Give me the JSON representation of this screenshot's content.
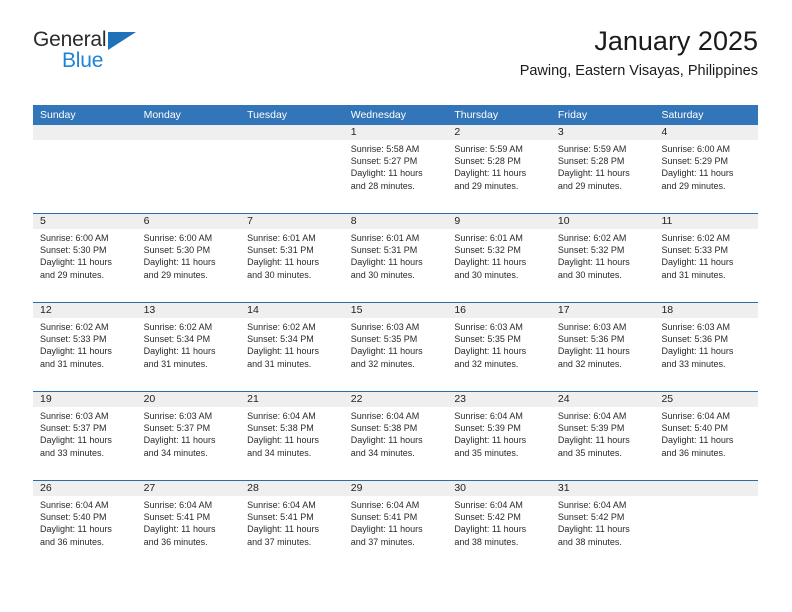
{
  "brand": {
    "name_part1": "General",
    "name_part2": "Blue",
    "triangle_color": "#1e72b8",
    "blue_color": "#1f84d6"
  },
  "header": {
    "title": "January 2025",
    "subtitle": "Pawing, Eastern Visayas, Philippines"
  },
  "theme": {
    "header_blue": "#3275b8",
    "separator_blue": "#2c6ca8",
    "day_band_gray": "#efefef"
  },
  "weekdays": [
    "Sunday",
    "Monday",
    "Tuesday",
    "Wednesday",
    "Thursday",
    "Friday",
    "Saturday"
  ],
  "weeks": [
    [
      {
        "day": "",
        "sunrise": "",
        "sunset": "",
        "daylight1": "",
        "daylight2": ""
      },
      {
        "day": "",
        "sunrise": "",
        "sunset": "",
        "daylight1": "",
        "daylight2": ""
      },
      {
        "day": "",
        "sunrise": "",
        "sunset": "",
        "daylight1": "",
        "daylight2": ""
      },
      {
        "day": "1",
        "sunrise": "Sunrise: 5:58 AM",
        "sunset": "Sunset: 5:27 PM",
        "daylight1": "Daylight: 11 hours",
        "daylight2": "and 28 minutes."
      },
      {
        "day": "2",
        "sunrise": "Sunrise: 5:59 AM",
        "sunset": "Sunset: 5:28 PM",
        "daylight1": "Daylight: 11 hours",
        "daylight2": "and 29 minutes."
      },
      {
        "day": "3",
        "sunrise": "Sunrise: 5:59 AM",
        "sunset": "Sunset: 5:28 PM",
        "daylight1": "Daylight: 11 hours",
        "daylight2": "and 29 minutes."
      },
      {
        "day": "4",
        "sunrise": "Sunrise: 6:00 AM",
        "sunset": "Sunset: 5:29 PM",
        "daylight1": "Daylight: 11 hours",
        "daylight2": "and 29 minutes."
      }
    ],
    [
      {
        "day": "5",
        "sunrise": "Sunrise: 6:00 AM",
        "sunset": "Sunset: 5:30 PM",
        "daylight1": "Daylight: 11 hours",
        "daylight2": "and 29 minutes."
      },
      {
        "day": "6",
        "sunrise": "Sunrise: 6:00 AM",
        "sunset": "Sunset: 5:30 PM",
        "daylight1": "Daylight: 11 hours",
        "daylight2": "and 29 minutes."
      },
      {
        "day": "7",
        "sunrise": "Sunrise: 6:01 AM",
        "sunset": "Sunset: 5:31 PM",
        "daylight1": "Daylight: 11 hours",
        "daylight2": "and 30 minutes."
      },
      {
        "day": "8",
        "sunrise": "Sunrise: 6:01 AM",
        "sunset": "Sunset: 5:31 PM",
        "daylight1": "Daylight: 11 hours",
        "daylight2": "and 30 minutes."
      },
      {
        "day": "9",
        "sunrise": "Sunrise: 6:01 AM",
        "sunset": "Sunset: 5:32 PM",
        "daylight1": "Daylight: 11 hours",
        "daylight2": "and 30 minutes."
      },
      {
        "day": "10",
        "sunrise": "Sunrise: 6:02 AM",
        "sunset": "Sunset: 5:32 PM",
        "daylight1": "Daylight: 11 hours",
        "daylight2": "and 30 minutes."
      },
      {
        "day": "11",
        "sunrise": "Sunrise: 6:02 AM",
        "sunset": "Sunset: 5:33 PM",
        "daylight1": "Daylight: 11 hours",
        "daylight2": "and 31 minutes."
      }
    ],
    [
      {
        "day": "12",
        "sunrise": "Sunrise: 6:02 AM",
        "sunset": "Sunset: 5:33 PM",
        "daylight1": "Daylight: 11 hours",
        "daylight2": "and 31 minutes."
      },
      {
        "day": "13",
        "sunrise": "Sunrise: 6:02 AM",
        "sunset": "Sunset: 5:34 PM",
        "daylight1": "Daylight: 11 hours",
        "daylight2": "and 31 minutes."
      },
      {
        "day": "14",
        "sunrise": "Sunrise: 6:02 AM",
        "sunset": "Sunset: 5:34 PM",
        "daylight1": "Daylight: 11 hours",
        "daylight2": "and 31 minutes."
      },
      {
        "day": "15",
        "sunrise": "Sunrise: 6:03 AM",
        "sunset": "Sunset: 5:35 PM",
        "daylight1": "Daylight: 11 hours",
        "daylight2": "and 32 minutes."
      },
      {
        "day": "16",
        "sunrise": "Sunrise: 6:03 AM",
        "sunset": "Sunset: 5:35 PM",
        "daylight1": "Daylight: 11 hours",
        "daylight2": "and 32 minutes."
      },
      {
        "day": "17",
        "sunrise": "Sunrise: 6:03 AM",
        "sunset": "Sunset: 5:36 PM",
        "daylight1": "Daylight: 11 hours",
        "daylight2": "and 32 minutes."
      },
      {
        "day": "18",
        "sunrise": "Sunrise: 6:03 AM",
        "sunset": "Sunset: 5:36 PM",
        "daylight1": "Daylight: 11 hours",
        "daylight2": "and 33 minutes."
      }
    ],
    [
      {
        "day": "19",
        "sunrise": "Sunrise: 6:03 AM",
        "sunset": "Sunset: 5:37 PM",
        "daylight1": "Daylight: 11 hours",
        "daylight2": "and 33 minutes."
      },
      {
        "day": "20",
        "sunrise": "Sunrise: 6:03 AM",
        "sunset": "Sunset: 5:37 PM",
        "daylight1": "Daylight: 11 hours",
        "daylight2": "and 34 minutes."
      },
      {
        "day": "21",
        "sunrise": "Sunrise: 6:04 AM",
        "sunset": "Sunset: 5:38 PM",
        "daylight1": "Daylight: 11 hours",
        "daylight2": "and 34 minutes."
      },
      {
        "day": "22",
        "sunrise": "Sunrise: 6:04 AM",
        "sunset": "Sunset: 5:38 PM",
        "daylight1": "Daylight: 11 hours",
        "daylight2": "and 34 minutes."
      },
      {
        "day": "23",
        "sunrise": "Sunrise: 6:04 AM",
        "sunset": "Sunset: 5:39 PM",
        "daylight1": "Daylight: 11 hours",
        "daylight2": "and 35 minutes."
      },
      {
        "day": "24",
        "sunrise": "Sunrise: 6:04 AM",
        "sunset": "Sunset: 5:39 PM",
        "daylight1": "Daylight: 11 hours",
        "daylight2": "and 35 minutes."
      },
      {
        "day": "25",
        "sunrise": "Sunrise: 6:04 AM",
        "sunset": "Sunset: 5:40 PM",
        "daylight1": "Daylight: 11 hours",
        "daylight2": "and 36 minutes."
      }
    ],
    [
      {
        "day": "26",
        "sunrise": "Sunrise: 6:04 AM",
        "sunset": "Sunset: 5:40 PM",
        "daylight1": "Daylight: 11 hours",
        "daylight2": "and 36 minutes."
      },
      {
        "day": "27",
        "sunrise": "Sunrise: 6:04 AM",
        "sunset": "Sunset: 5:41 PM",
        "daylight1": "Daylight: 11 hours",
        "daylight2": "and 36 minutes."
      },
      {
        "day": "28",
        "sunrise": "Sunrise: 6:04 AM",
        "sunset": "Sunset: 5:41 PM",
        "daylight1": "Daylight: 11 hours",
        "daylight2": "and 37 minutes."
      },
      {
        "day": "29",
        "sunrise": "Sunrise: 6:04 AM",
        "sunset": "Sunset: 5:41 PM",
        "daylight1": "Daylight: 11 hours",
        "daylight2": "and 37 minutes."
      },
      {
        "day": "30",
        "sunrise": "Sunrise: 6:04 AM",
        "sunset": "Sunset: 5:42 PM",
        "daylight1": "Daylight: 11 hours",
        "daylight2": "and 38 minutes."
      },
      {
        "day": "31",
        "sunrise": "Sunrise: 6:04 AM",
        "sunset": "Sunset: 5:42 PM",
        "daylight1": "Daylight: 11 hours",
        "daylight2": "and 38 minutes."
      },
      {
        "day": "",
        "sunrise": "",
        "sunset": "",
        "daylight1": "",
        "daylight2": ""
      }
    ]
  ]
}
